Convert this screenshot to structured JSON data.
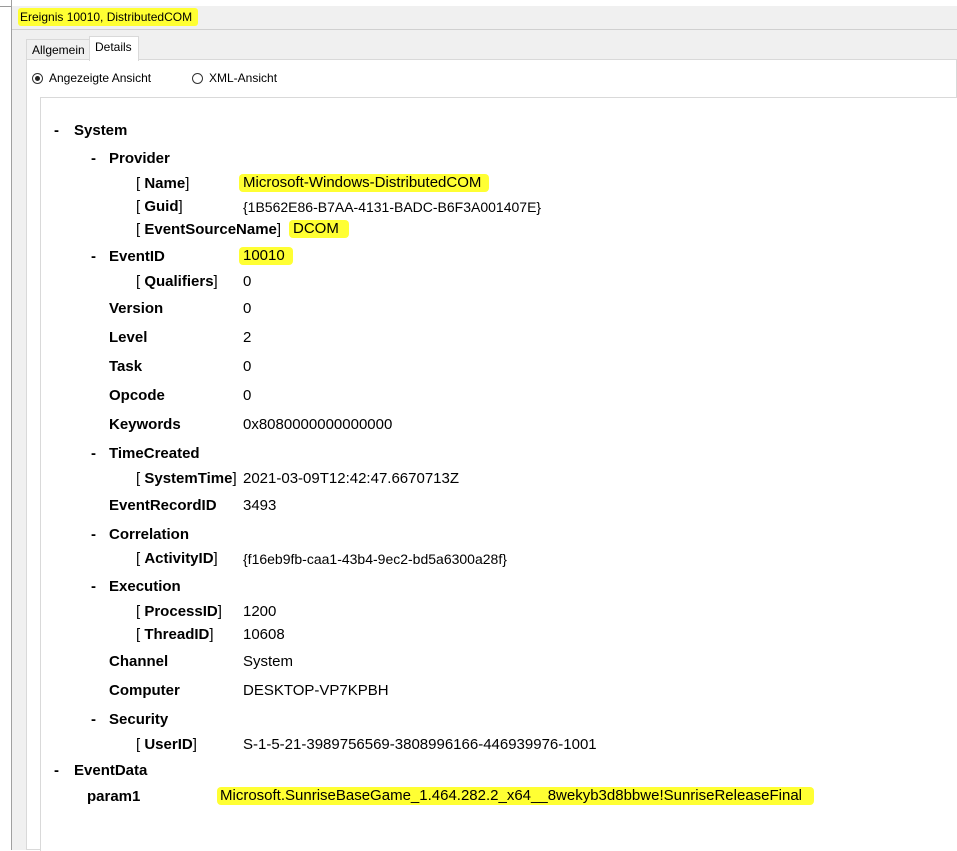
{
  "title": "Ereignis 10010, DistributedCOM",
  "tabs": [
    {
      "label": "Allgemein"
    },
    {
      "label": "Details"
    }
  ],
  "views": [
    {
      "label": "Angezeigte Ansicht",
      "selected": true
    },
    {
      "label": "XML-Ansicht",
      "selected": false
    }
  ],
  "highlight_color": "#ffff33",
  "tree": {
    "system": "System",
    "provider": "Provider",
    "name_key": "Name",
    "name_val": "Microsoft-Windows-DistributedCOM",
    "guid_key": "Guid",
    "guid_val": "{1B562E86-B7AA-4131-BADC-B6F3A001407E}",
    "esn_key": "EventSourceName",
    "esn_val": "DCOM",
    "eventid_key": "EventID",
    "eventid_val": "10010",
    "qual_key": "Qualifiers",
    "qual_val": "0",
    "version_key": "Version",
    "version_val": "0",
    "level_key": "Level",
    "level_val": "2",
    "task_key": "Task",
    "task_val": "0",
    "opcode_key": "Opcode",
    "opcode_val": "0",
    "keywords_key": "Keywords",
    "keywords_val": "0x8080000000000000",
    "timecreated_key": "TimeCreated",
    "systemtime_key": "SystemTime",
    "systemtime_val": "2021-03-09T12:42:47.6670713Z",
    "recordid_key": "EventRecordID",
    "recordid_val": "3493",
    "correlation_key": "Correlation",
    "activityid_key": "ActivityID",
    "activityid_val": "{f16eb9fb-caa1-43b4-9ec2-bd5a6300a28f}",
    "execution_key": "Execution",
    "processid_key": "ProcessID",
    "processid_val": "1200",
    "threadid_key": "ThreadID",
    "threadid_val": "10608",
    "channel_key": "Channel",
    "channel_val": "System",
    "computer_key": "Computer",
    "computer_val": "DESKTOP-VP7KPBH",
    "security_key": "Security",
    "userid_key": "UserID",
    "userid_val": "S-1-5-21-3989756569-3808996166-446939976-1001",
    "eventdata_key": "EventData",
    "param1_key": "param1",
    "param1_val": "Microsoft.SunriseBaseGame_1.464.282.2_x64__8wekyb3d8bbwe!SunriseReleaseFinal"
  }
}
